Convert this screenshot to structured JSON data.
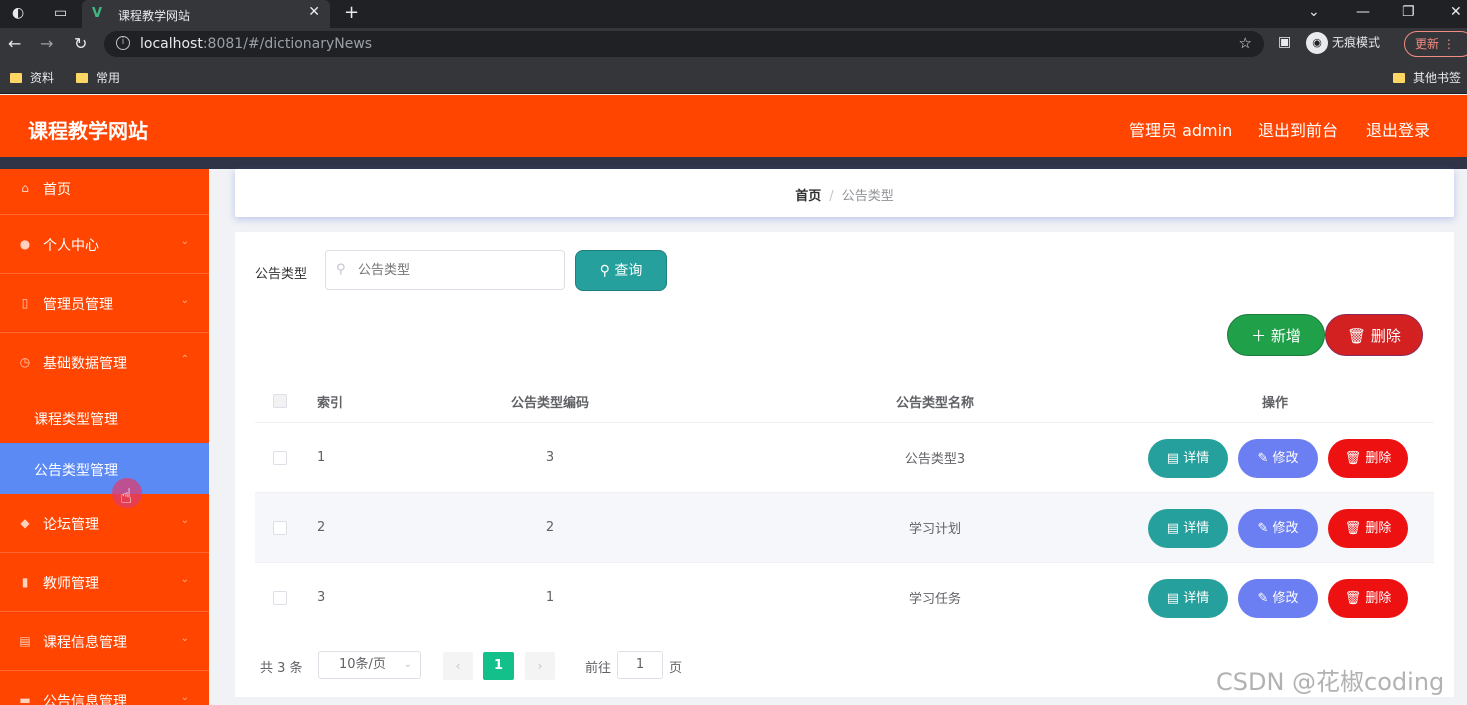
{
  "browser": {
    "tab_title": "课程教学网站",
    "tab_close": "✕",
    "new_tab": "+",
    "url_host": "localhost",
    "url_rest": ":8081/#/dictionaryNews",
    "incognito_label": "无痕模式",
    "update_label": "更新",
    "bookmarks": [
      "资料",
      "常用",
      "其他书签"
    ]
  },
  "header": {
    "title": "课程教学网站",
    "admin_label": "管理员 admin",
    "exit_front_label": "退出到前台",
    "logout_label": "退出登录"
  },
  "sidebar": {
    "items": [
      {
        "label": "首页",
        "icon": "home-icon"
      },
      {
        "label": "个人中心",
        "icon": "user-icon"
      },
      {
        "label": "管理员管理",
        "icon": "admin-icon"
      },
      {
        "label": "基础数据管理",
        "icon": "data-icon"
      }
    ],
    "subitems": [
      {
        "label": "课程类型管理"
      },
      {
        "label": "公告类型管理",
        "active": true
      }
    ],
    "items2": [
      {
        "label": "论坛管理",
        "icon": "forum-icon"
      },
      {
        "label": "教师管理",
        "icon": "chart-icon"
      },
      {
        "label": "课程信息管理",
        "icon": "course-icon"
      },
      {
        "label": "公告信息管理",
        "icon": "notice-icon"
      }
    ]
  },
  "breadcrumb": {
    "home": "首页",
    "separator": "/",
    "current": "公告类型"
  },
  "search": {
    "label": "公告类型",
    "placeholder": "公告类型",
    "button_label": "查询"
  },
  "actions": {
    "add_label": "新增",
    "delete_label": "删除"
  },
  "table": {
    "headers": {
      "index": "索引",
      "code": "公告类型编码",
      "name": "公告类型名称",
      "op": "操作"
    },
    "rows": [
      {
        "index": "1",
        "code": "3",
        "name": "公告类型3"
      },
      {
        "index": "2",
        "code": "2",
        "name": "学习计划"
      },
      {
        "index": "3",
        "code": "1",
        "name": "学习任务"
      }
    ],
    "row_buttons": {
      "detail": "详情",
      "edit": "修改",
      "delete": "删除"
    }
  },
  "pagination": {
    "total": "共 3 条",
    "page_size": "10条/页",
    "current_page": "1",
    "goto_label": "前往",
    "goto_value": "1",
    "page_unit": "页"
  },
  "watermark": "CSDN @花椒coding",
  "colors": {
    "brand": "#ff4500",
    "active_menu": "#5b8af5",
    "teal": "#26a09c",
    "green": "#21a04a",
    "red": "#ee1111",
    "purple": "#6b7ff2"
  }
}
